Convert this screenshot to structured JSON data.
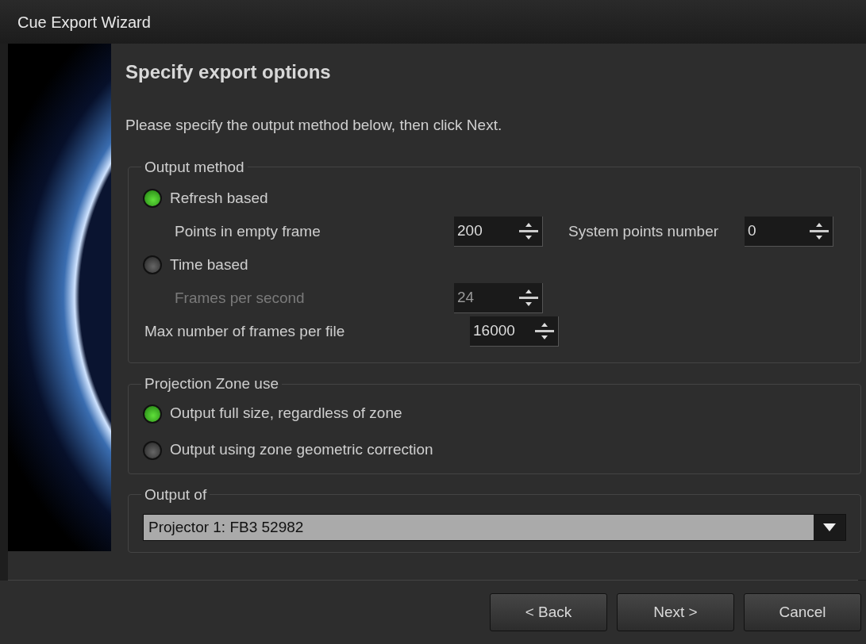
{
  "window": {
    "title": "Cue Export Wizard"
  },
  "page": {
    "heading": "Specify export options",
    "instruction": "Please specify the output method below, then click Next."
  },
  "output_method": {
    "legend": "Output method",
    "items": [
      {
        "kind": "radio",
        "label": "Refresh based",
        "selected": true,
        "children": [
          {
            "kind": "spin",
            "label": "Points in empty frame",
            "value": "200",
            "disabled": false,
            "extra": {
              "label": "System points number",
              "value": "0"
            }
          }
        ]
      },
      {
        "kind": "radio",
        "label": "Time based",
        "selected": false,
        "children": [
          {
            "kind": "spin",
            "label": "Frames per second",
            "value": "24",
            "disabled": true
          }
        ]
      },
      {
        "kind": "spin",
        "label": "Max number of frames per file",
        "value": "16000",
        "disabled": false
      }
    ]
  },
  "projection_zone": {
    "legend": "Projection Zone use",
    "options": [
      {
        "label": "Output full size, regardless of zone",
        "selected": true
      },
      {
        "label": "Output using zone geometric correction",
        "selected": false
      }
    ]
  },
  "output_of": {
    "legend": "Output of",
    "value": "Projector 1: FB3 52982"
  },
  "buttons": [
    {
      "label": "< Back"
    },
    {
      "label": "Next >"
    },
    {
      "label": "Cancel"
    }
  ]
}
